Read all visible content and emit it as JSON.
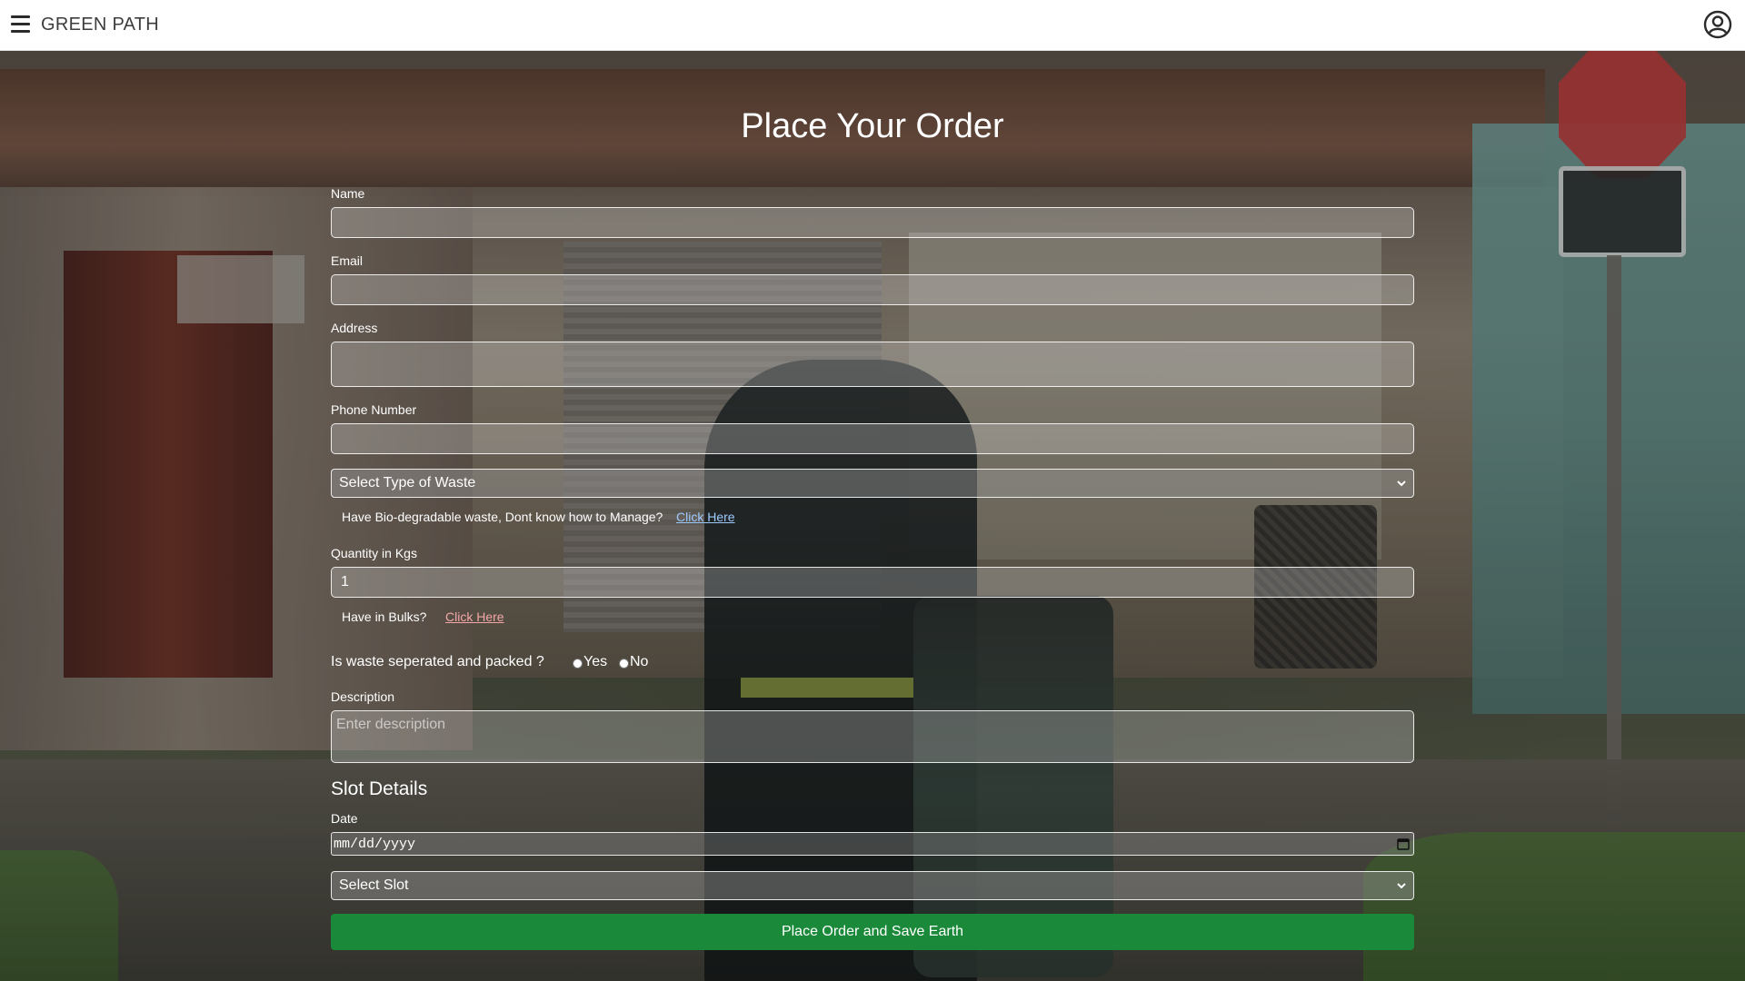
{
  "header": {
    "brand": "GREEN PATH",
    "menu_icon": "hamburger-menu-icon",
    "account_icon": "user-circle-icon"
  },
  "form": {
    "title": "Place Your Order",
    "name_label": "Name",
    "name_value": "",
    "email_label": "Email",
    "email_value": "",
    "address_label": "Address",
    "address_value": "",
    "phone_label": "Phone Number",
    "phone_value": "",
    "waste_type_selected": "Select Type of Waste",
    "bio_hint": "Have Bio-degradable waste, Dont know how to Manage?",
    "bio_link": "Click Here",
    "quantity_label": "Quantity in Kgs",
    "quantity_value": "1",
    "bulk_hint": "Have in Bulks?",
    "bulk_link": "Click Here",
    "separated_question": "Is waste seperated and packed ?",
    "radio_yes": "Yes",
    "radio_no": "No",
    "description_label": "Description",
    "description_placeholder": "Enter description",
    "slot_section_title": "Slot Details",
    "date_label": "Date",
    "date_placeholder": "mm/dd/yyyy",
    "slot_selected": "Select Slot",
    "submit_label": "Place Order and Save Earth"
  },
  "colors": {
    "submit_bg": "#1a8a3a",
    "bio_link": "#9ec9ff",
    "bulk_link": "#f4a7a7"
  }
}
